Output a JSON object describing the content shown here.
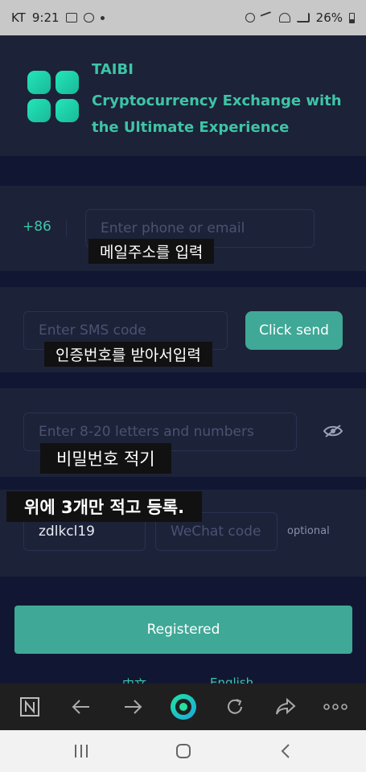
{
  "status_bar": {
    "carrier": "KT",
    "time": "9:21",
    "battery": "26%"
  },
  "header": {
    "brand": "TAIBI",
    "tagline": "Cryptocurrency Exchange with the Ultimate Experience"
  },
  "phone": {
    "country_code": "+86",
    "placeholder": "Enter phone or email",
    "overlay": "메일주소를 입력"
  },
  "sms": {
    "placeholder": "Enter SMS code",
    "send_label": "Click send",
    "overlay": "인증번호를 받아서입력"
  },
  "password": {
    "placeholder": "Enter 8-20 letters and numbers",
    "overlay": "비밀번호 적기"
  },
  "invite": {
    "overlay": "위에 3개만 적고 등록.",
    "invite_value": "zdlkcl19",
    "wechat_placeholder": "WeChat code",
    "optional_label": "optional"
  },
  "register_label": "Registered",
  "languages": [
    "中文",
    "English"
  ],
  "browser_toolbar": {
    "items": [
      "notes-icon",
      "back-arrow-icon",
      "forward-arrow-icon",
      "home-circle-icon",
      "refresh-icon",
      "share-icon",
      "more-icon"
    ]
  },
  "system_nav": {
    "items": [
      "recent-apps-icon",
      "home-icon",
      "back-icon"
    ]
  },
  "colors": {
    "accent": "#3ec4a6",
    "button": "#3fa896",
    "bg": "#111733",
    "panel": "#1c2238"
  }
}
